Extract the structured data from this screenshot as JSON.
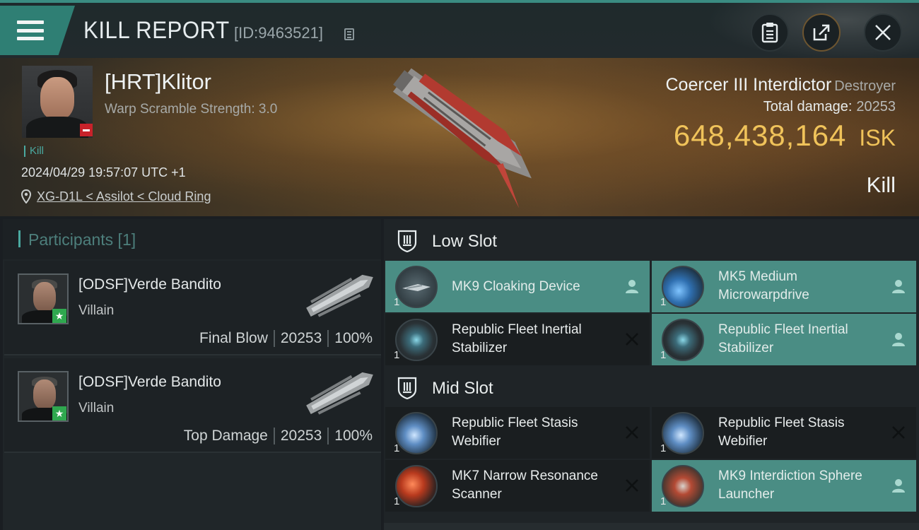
{
  "header": {
    "title": "KILL REPORT",
    "report_id": "[ID:9463521]"
  },
  "victim": {
    "pilot_name": "[HRT]Klitor",
    "warp_scramble": "Warp Scramble Strength: 3.0",
    "event_tag": "Kill",
    "datetime": "2024/04/29 19:57:07 UTC +1",
    "location": "XG-D1L < Assilot < Cloud Ring"
  },
  "ship": {
    "name": "Coercer III Interdictor",
    "class": "Destroyer",
    "total_damage_label": "Total damage:",
    "total_damage_value": "20253",
    "isk_value": "648,438,164",
    "isk_unit": "ISK",
    "result": "Kill"
  },
  "participants": {
    "title": "Participants [1]",
    "rows": [
      {
        "name": "[ODSF]Verde Bandito",
        "role": "Villain",
        "tag": "Final Blow",
        "damage": "20253",
        "percent": "100%"
      },
      {
        "name": "[ODSF]Verde Bandito",
        "role": "Villain",
        "tag": "Top Damage",
        "damage": "20253",
        "percent": "100%"
      }
    ]
  },
  "slots": {
    "low": {
      "title": "Low Slot",
      "modules": [
        {
          "name": "MK9 Cloaking Device",
          "qty": "1",
          "status": "fitted",
          "icon": "cloak-icon"
        },
        {
          "name": "MK5 Medium Microwarpdrive",
          "qty": "1",
          "status": "fitted",
          "icon": "microwarpdrive-icon"
        },
        {
          "name": "Republic Fleet Inertial Stabilizer",
          "qty": "1",
          "status": "destroyed",
          "icon": "inertial-stabilizer-icon"
        },
        {
          "name": "Republic Fleet Inertial Stabilizer",
          "qty": "1",
          "status": "fitted",
          "icon": "inertial-stabilizer-icon"
        }
      ]
    },
    "mid": {
      "title": "Mid Slot",
      "modules": [
        {
          "name": "Republic Fleet Stasis Webifier",
          "qty": "1",
          "status": "destroyed",
          "icon": "webifier-icon"
        },
        {
          "name": "Republic Fleet Stasis Webifier",
          "qty": "1",
          "status": "destroyed",
          "icon": "webifier-icon"
        },
        {
          "name": "MK7 Narrow Resonance Scanner",
          "qty": "1",
          "status": "destroyed",
          "icon": "scanner-icon"
        },
        {
          "name": "MK9 Interdiction Sphere Launcher",
          "qty": "1",
          "status": "fitted",
          "icon": "sphere-launcher-icon"
        }
      ]
    }
  },
  "colors": {
    "accent": "#4a8d84",
    "isk": "#f0c35a",
    "alert": "#c8222a",
    "badge": "#2fa84f"
  }
}
